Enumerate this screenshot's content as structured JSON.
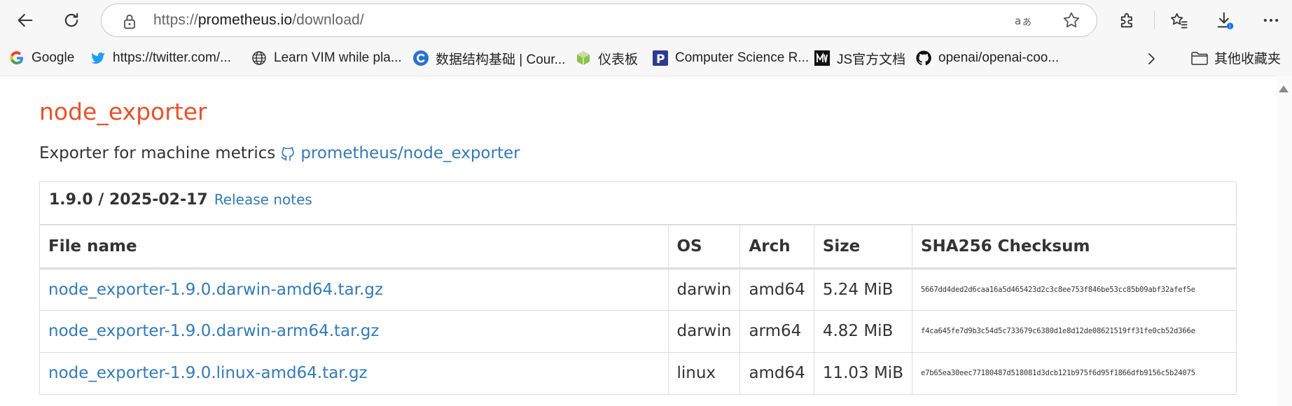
{
  "browser": {
    "url_scheme": "https://",
    "url_host": "prometheus.io",
    "url_path": "/download/",
    "icons": {
      "back": "arrow-left-icon",
      "refresh": "refresh-icon",
      "lock": "lock-icon",
      "read_aloud": "read-aloud-icon",
      "favorite": "star-icon",
      "extensions": "puzzle-icon",
      "favorites": "favorites-icon",
      "downloads": "download-icon",
      "menu": "more-icon"
    }
  },
  "bookmarks": {
    "items": [
      {
        "label": "Google",
        "icon": "google-icon"
      },
      {
        "label": "https://twitter.com/...",
        "icon": "twitter-icon"
      },
      {
        "label": "Learn VIM while pla...",
        "icon": "globe-icon"
      },
      {
        "label": "数据结构基础 | Cour...",
        "icon": "coursera-icon"
      },
      {
        "label": "仪表板",
        "icon": "cube-icon"
      },
      {
        "label": "Computer Science R...",
        "icon": "p-icon"
      },
      {
        "label": "JS官方文档",
        "icon": "m-icon"
      },
      {
        "label": "openai/openai-coo...",
        "icon": "github-icon"
      }
    ],
    "other_label": "其他收藏夹"
  },
  "page": {
    "title": "node_exporter",
    "description": "Exporter for machine metrics",
    "repo_link": "prometheus/node_exporter",
    "release": {
      "version": "1.9.0 / 2025-02-17",
      "notes_link": "Release notes"
    },
    "table": {
      "headers": [
        "File name",
        "OS",
        "Arch",
        "Size",
        "SHA256 Checksum"
      ],
      "rows": [
        {
          "file": "node_exporter-1.9.0.darwin-amd64.tar.gz",
          "os": "darwin",
          "arch": "amd64",
          "size": "5.24 MiB",
          "sha": "5667dd4ded2d6caa16a5d465423d2c3c8ee753f846be53cc85b09abf32afef5e"
        },
        {
          "file": "node_exporter-1.9.0.darwin-arm64.tar.gz",
          "os": "darwin",
          "arch": "arm64",
          "size": "4.82 MiB",
          "sha": "f4ca645fe7d9b3c54d5c733679c6380d1e8d12de08621519ff31fe0cb52d366e"
        },
        {
          "file": "node_exporter-1.9.0.linux-amd64.tar.gz",
          "os": "linux",
          "arch": "amd64",
          "size": "11.03 MiB",
          "sha": "e7b65ea30eec77180487d518081d3dcb121b975f6d95f1866dfb9156c5b24075"
        }
      ]
    }
  },
  "colors": {
    "title": "#e6522c",
    "link": "#337ab7",
    "text": "#333333",
    "border": "#dddddd"
  }
}
